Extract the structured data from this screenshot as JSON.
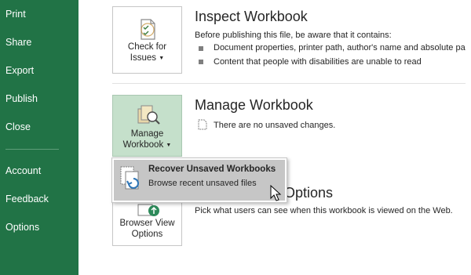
{
  "nav": {
    "items": [
      "Print",
      "Share",
      "Export",
      "Publish",
      "Close"
    ],
    "bottom_items": [
      "Account",
      "Feedback",
      "Options"
    ]
  },
  "inspect": {
    "button_line1": "Check for",
    "button_line2": "Issues",
    "title": "Inspect Workbook",
    "intro": "Before publishing this file, be aware that it contains:",
    "bullets": [
      "Document properties, printer path, author's name and absolute pa",
      "Content that people with disabilities are unable to read"
    ]
  },
  "manage": {
    "button_line1": "Manage",
    "button_line2": "Workbook",
    "title": "Manage Workbook",
    "status": "There are no unsaved changes."
  },
  "browser": {
    "button_line1": "Browser View",
    "button_line2": "Options",
    "title_visible": "Options",
    "description": "Pick what users can see when this workbook is viewed on the Web."
  },
  "dropdown": {
    "title": "Recover Unsaved Workbooks",
    "subtitle": "Browse recent unsaved files"
  },
  "colors": {
    "nav_bg": "#217346",
    "active_button_bg": "#c5e0cb",
    "dropdown_highlight": "#c6c6c6"
  }
}
